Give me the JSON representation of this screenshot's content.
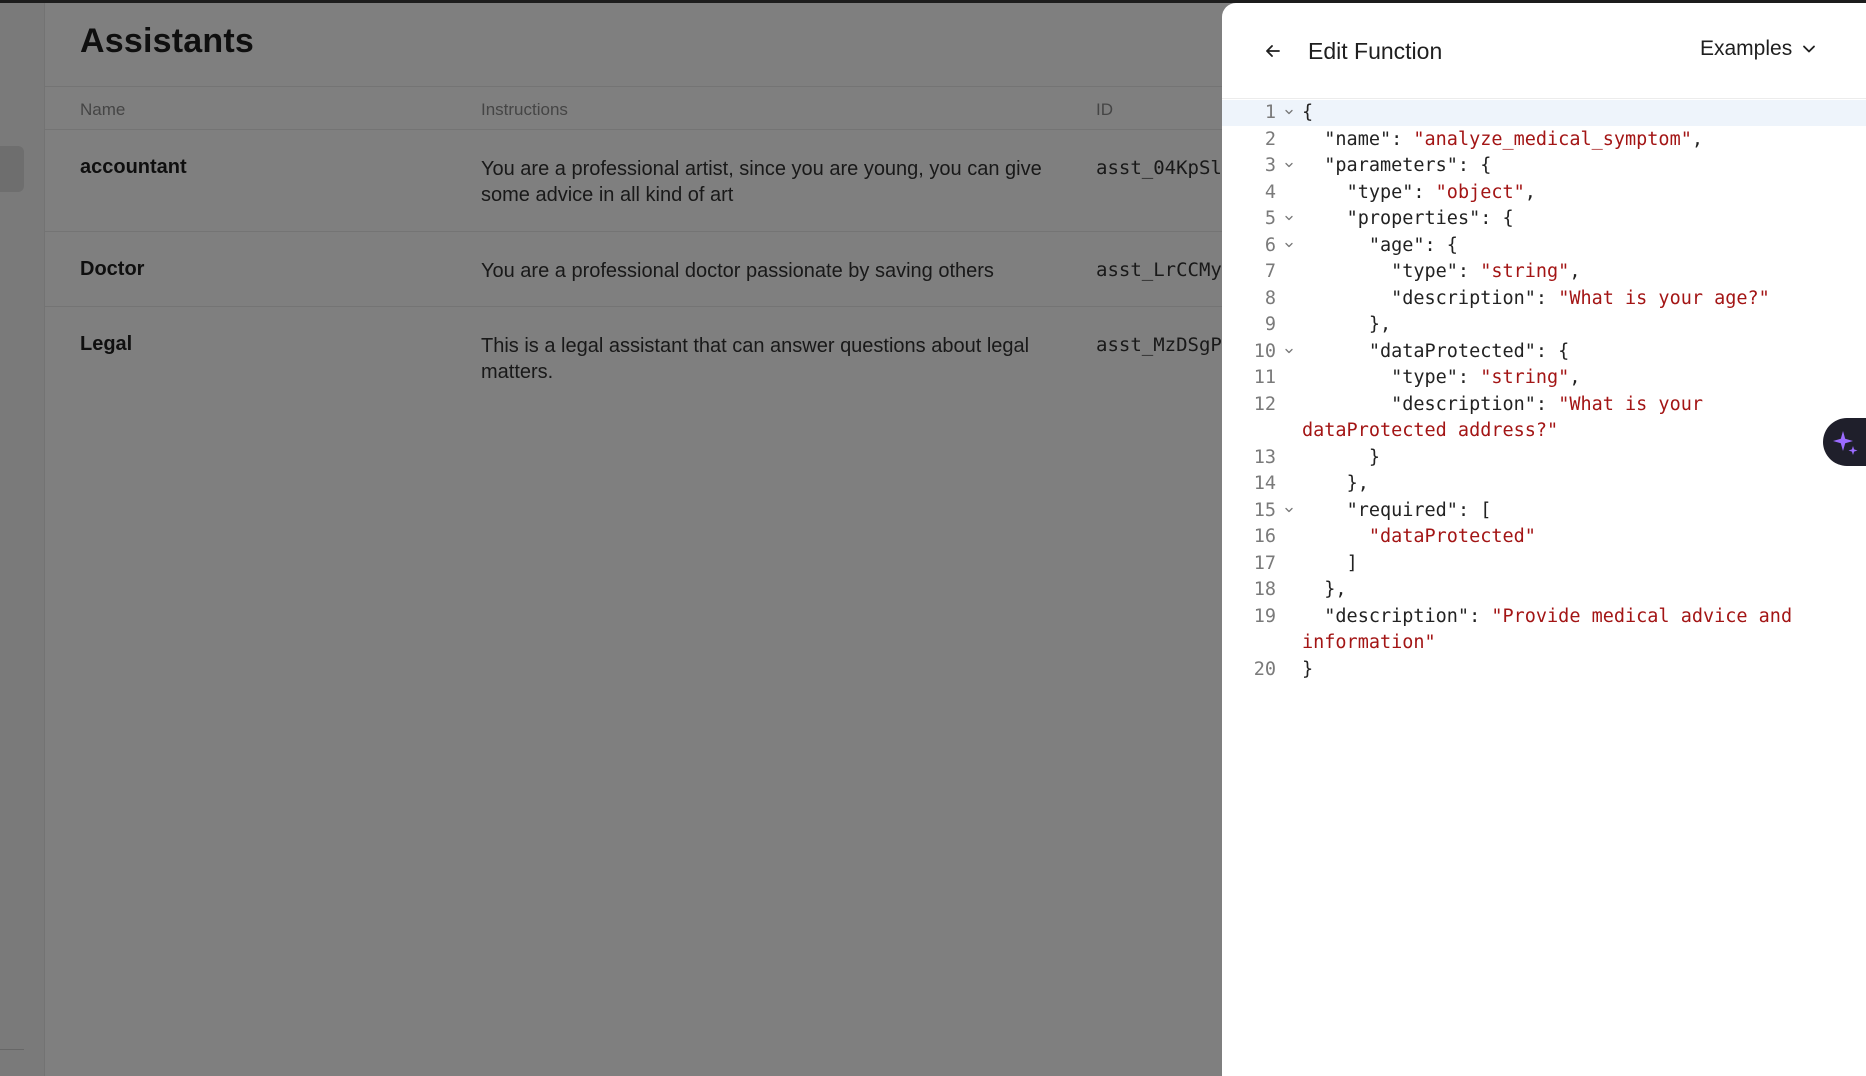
{
  "page": {
    "title": "Assistants",
    "columns": [
      "Name",
      "Instructions",
      "ID"
    ],
    "rows": [
      {
        "name": "accountant",
        "instructions": "You are a professional artist, since you are young, you can give some advice in all kind of art",
        "id": "asst_04KpSl"
      },
      {
        "name": "Doctor",
        "instructions": "You are a professional doctor passionate by saving others",
        "id": "asst_LrCCMy"
      },
      {
        "name": "Legal",
        "instructions": "This is a legal assistant that can answer questions about legal matters.",
        "id": "asst_MzDSgP"
      }
    ]
  },
  "drawer": {
    "back_icon": "arrow-left-icon",
    "title": "Edit Function",
    "examples_label": "Examples",
    "examples_icon": "chevron-down-icon"
  },
  "editor": {
    "lines": [
      {
        "n": "1",
        "fold": true,
        "html": "{"
      },
      {
        "n": "2",
        "fold": false,
        "html": "  \"name\": <span class=\"s\">\"analyze_medical_symptom\"</span>,"
      },
      {
        "n": "3",
        "fold": true,
        "html": "  \"parameters\": {"
      },
      {
        "n": "4",
        "fold": false,
        "html": "    \"type\": <span class=\"s\">\"object\"</span>,"
      },
      {
        "n": "5",
        "fold": true,
        "html": "    \"properties\": {"
      },
      {
        "n": "6",
        "fold": true,
        "html": "      \"age\": {"
      },
      {
        "n": "7",
        "fold": false,
        "html": "        \"type\": <span class=\"s\">\"string\"</span>,"
      },
      {
        "n": "8",
        "fold": false,
        "html": "        \"description\": <span class=\"s\">\"What is your age?\"</span>"
      },
      {
        "n": "9",
        "fold": false,
        "html": "      },"
      },
      {
        "n": "10",
        "fold": true,
        "html": "      \"dataProtected\": {"
      },
      {
        "n": "11",
        "fold": false,
        "html": "        \"type\": <span class=\"s\">\"string\"</span>,"
      },
      {
        "n": "12",
        "fold": false,
        "html": "        \"description\": <span class=\"s\">\"What is your dataProtected address?\"</span>"
      },
      {
        "n": "13",
        "fold": false,
        "html": "      }"
      },
      {
        "n": "14",
        "fold": false,
        "html": "    },"
      },
      {
        "n": "15",
        "fold": true,
        "html": "    \"required\": ["
      },
      {
        "n": "16",
        "fold": false,
        "html": "      <span class=\"s\">\"dataProtected\"</span>"
      },
      {
        "n": "17",
        "fold": false,
        "html": "    ]"
      },
      {
        "n": "18",
        "fold": false,
        "html": "  },"
      },
      {
        "n": "19",
        "fold": false,
        "html": "  \"description\": <span class=\"s\">\"Provide medical advice and information\"</span>"
      },
      {
        "n": "20",
        "fold": false,
        "html": "}"
      }
    ]
  },
  "ai_button": {
    "icon": "sparkle-icon",
    "accent": "#9b6bff"
  },
  "colors": {
    "overlay": "rgba(0,0,0,0.5)",
    "string": "#a31515",
    "active_line": "#eef4fb"
  }
}
